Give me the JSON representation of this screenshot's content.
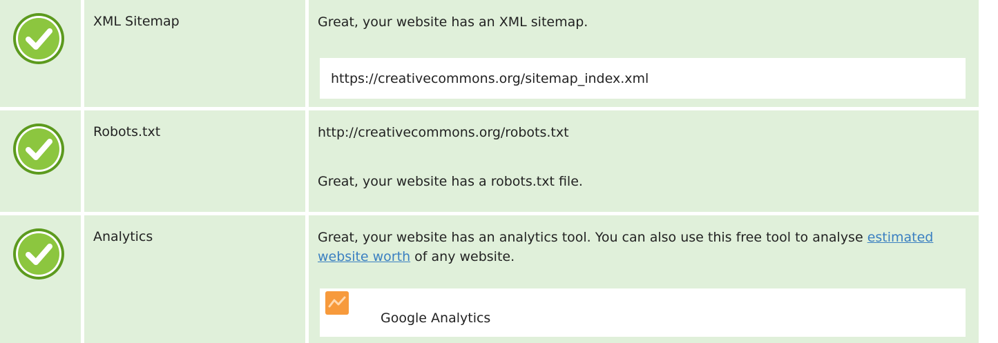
{
  "rows": [
    {
      "status": "pass",
      "name": "XML Sitemap",
      "message": "Great, your website has an XML sitemap.",
      "value": "https://creativecommons.org/sitemap_index.xml"
    },
    {
      "status": "pass",
      "name": "Robots.txt",
      "value": "http://creativecommons.org/robots.txt",
      "message": "Great, your website has a robots.txt file."
    },
    {
      "status": "pass",
      "name": "Analytics",
      "message_before_link": "Great, your website has an analytics tool. You can also use this free tool to analyse ",
      "link_text": "estimated website worth",
      "message_after_link": " of any website.",
      "tool": {
        "icon": "google-analytics-icon",
        "name": "Google Analytics"
      }
    }
  ],
  "icons": {
    "status_pass": "check-circle-icon"
  },
  "colors": {
    "row_background": "#e0f0da",
    "value_background": "#ffffff",
    "check_circle": "#8cc63f",
    "check_ring": "#5c9a1e",
    "link": "#3a7fc1",
    "analytics_icon": "#f79a3c"
  }
}
